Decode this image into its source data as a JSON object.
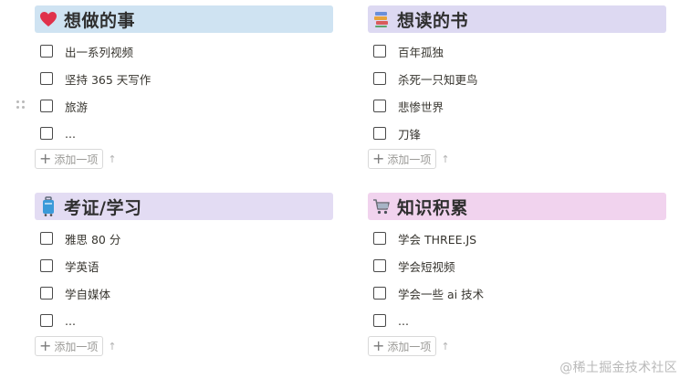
{
  "sections": [
    {
      "title": "想做的事",
      "icon": "heart-icon",
      "items": [
        "出一系列视频",
        "坚持 365 天写作",
        "旅游",
        "..."
      ],
      "add_label": "添加一项"
    },
    {
      "title": "想读的书",
      "icon": "books-icon",
      "items": [
        "百年孤独",
        "杀死一只知更鸟",
        "悲惨世界",
        "刀锋"
      ],
      "add_label": "添加一项"
    },
    {
      "title": "考证/学习",
      "icon": "luggage-icon",
      "items": [
        "雅思 80 分",
        "学英语",
        "学自媒体",
        "..."
      ],
      "add_label": "添加一项"
    },
    {
      "title": "知识积累",
      "icon": "shopping-cart-icon",
      "items": [
        "学会 THREE.JS",
        "学会短视频",
        "学会一些 ai 技术",
        "..."
      ],
      "add_label": "添加一项"
    }
  ],
  "watermark": "@稀土掘金技术社区",
  "colors": {
    "header_blue": "#cfe3f2",
    "header_lavender": "#ddd9f2",
    "header_purple": "#e3dcf3",
    "header_pink": "#f1d3ee",
    "text": "#37352f"
  }
}
